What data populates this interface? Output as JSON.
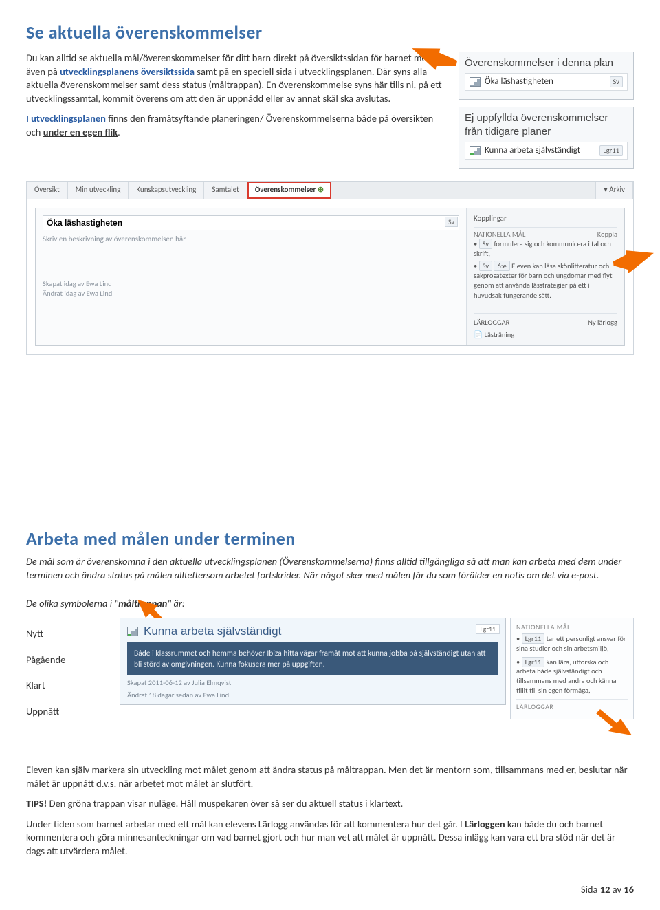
{
  "heading1": "Se aktuella överenskommelser",
  "intro_html": [
    "Du kan alltid se aktuella mål/överenskommelser för ditt barn direkt på översiktssidan för barnet men även på ",
    "utvecklingsplanens översiktssida",
    " samt på en speciell sida i utvecklingsplanen. Där syns alla aktuella överenskommelser samt dess status (måltrappan). En överenskommelse syns här tills ni, på ett utvecklingssamtal, kommit överens om att den är uppnådd eller av annat skäl ska avslutas."
  ],
  "intro2_a": "I utvecklingsplanen",
  "intro2_b": " finns den framåtsyftande planeringen/ Överenskommelserna både på översikten och ",
  "intro2_c": "under en egen flik",
  "intro2_d": ".",
  "panel1": {
    "title": "Överenskommelser i denna plan",
    "item": "Öka läshastigheten",
    "tag": "Sv"
  },
  "panel2": {
    "title": "Ej uppfyllda överenskommelser från tidigare planer",
    "item": "Kunna arbeta självständigt",
    "tag": "Lgr11"
  },
  "tabs": {
    "t1": "Översikt",
    "t2": "Min utveckling",
    "t3": "Kunskapsutveckling",
    "t4": "Samtalet",
    "t5": "Överenskommelser",
    "arkiv": "Arkiv"
  },
  "editor": {
    "goal": "Öka läshastigheten",
    "sv": "Sv",
    "placeholder": "Skriv en beskrivning av överenskommelsen här",
    "created": "Skapat idag av Ewa Lind",
    "changed": "Ändrat idag av Ewa Lind",
    "kopplingar": "Kopplingar",
    "nat_head": "NATIONELLA MÅL",
    "koppla": "Koppla",
    "line1_tag": "Sv",
    "line1": "formulera sig och kommunicera i tal och skrift,",
    "line2_tag1": "Sv",
    "line2_tag2": "6:e",
    "line2": "Eleven kan läsa skönlitteratur och sakprosatexter för barn och ungdomar med flyt genom att använda lässtrategier på ett i huvudsak fungerande sätt.",
    "larloggar": "LÄRLOGGAR",
    "nylarlogg": "Ny lärlogg",
    "lastraning": "Lästräning"
  },
  "heading2": "Arbeta med målen under terminen",
  "p2": "De mål som är överenskomna i den aktuella utvecklingsplanen (Överenskommelserna) finns alltid tillgängliga så att man kan arbeta med dem under terminen och ändra status på målen allteftersom arbetet fortskrider. När något sker med målen får du som förälder en notis om det via e-post.",
  "sym_intro_a": "De olika symbolerna i \"",
  "sym_intro_b": "måltrappan",
  "sym_intro_c": "\" är:",
  "sym": {
    "nytt": "Nytt",
    "pag": "Pågående",
    "klart": "Klart",
    "upp": "Uppnått"
  },
  "goal_card": {
    "title": "Kunna arbeta självständigt",
    "tag": "Lgr11",
    "body": "Både i klassrummet och hemma behöver Ibiza hitta vägar framåt mot att kunna jobba på självständigt utan att bli störd av omgivningen. Kunna fokusera mer på uppgiften.",
    "created": "Skapat 2011-06-12 av Julia Elmqvist",
    "changed": "Ändrat 18 dagar sedan av Ewa Lind"
  },
  "goal_side": {
    "head": "NATIONELLA MÅL",
    "tag": "Lgr11",
    "l1": "tar ett personligt ansvar för sina studier och sin arbetsmiljö,",
    "l2": "kan lära, utforska och arbeta både självständigt och tillsammans med andra och känna tillit till sin egen förmåga,",
    "larloggar": "LÄRLOGGAR"
  },
  "p3": "Eleven kan själv markera sin utveckling mot målet genom att ändra status på måltrappan. Men det är mentorn som, tillsammans med er, beslutar när målet är uppnått d.v.s. när arbetet mot målet är slutfört.",
  "tips_label": "TIPS!",
  "tips_text": " Den gröna trappan visar nuläge. Håll muspekaren över så ser du aktuell status i klartext.",
  "p4a": "Under tiden som barnet arbetar med ett mål kan elevens Lärlogg användas för att kommentera hur det går. I ",
  "p4b": "Lärloggen",
  "p4c": " kan både du och barnet kommentera och göra minnesanteckningar om vad barnet gjort och hur man vet att målet är uppnått. Dessa inlägg kan vara ett bra stöd när det är dags att utvärdera målet.",
  "footer_a": "Sida ",
  "footer_b": "12",
  "footer_c": " av ",
  "footer_d": "16"
}
